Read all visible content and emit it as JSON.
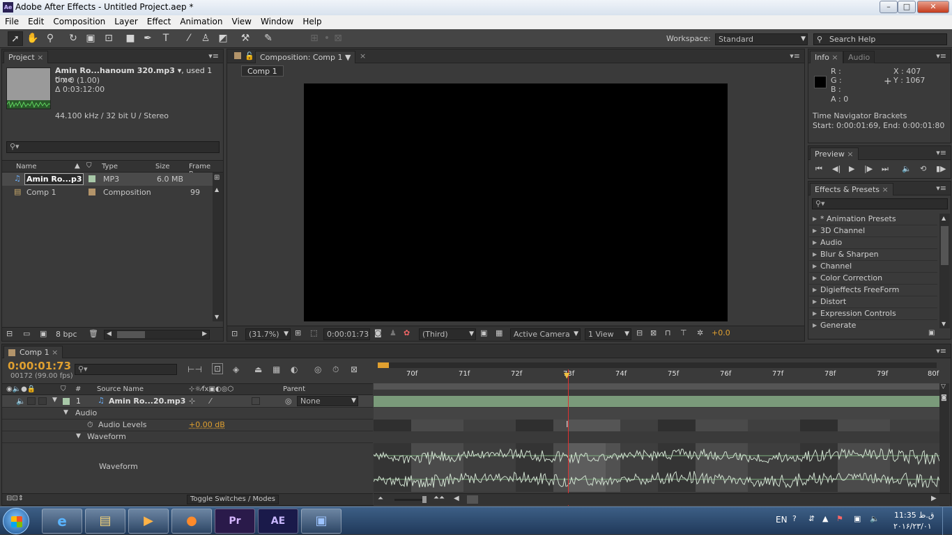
{
  "window": {
    "title": "Adobe After Effects - Untitled Project.aep *",
    "app_icon": "Ae",
    "min": "–",
    "max": "□",
    "close": "✕"
  },
  "menu": [
    "File",
    "Edit",
    "Composition",
    "Layer",
    "Effect",
    "Animation",
    "View",
    "Window",
    "Help"
  ],
  "toolbar": {
    "workspace_label": "Workspace:",
    "workspace_value": "Standard",
    "search_placeholder": "Search Help"
  },
  "project": {
    "tab": "Project",
    "item_title": "Amin Ro...hanoum 320.mp3",
    "item_used": ", used 1 time",
    "item_dims": "0 x 0 (1.00)",
    "item_duration": "Δ 0:03:12:00",
    "item_audio": "44.100 kHz / 32 bit U / Stereo",
    "columns": [
      "Name",
      "Type",
      "Size",
      "Frame R..."
    ],
    "rows": [
      {
        "name": "Amin Ro...p3",
        "type": "MP3",
        "size": "6.0 MB",
        "rate": "",
        "color": "#a8c8a8"
      },
      {
        "name": "Comp 1",
        "type": "Composition",
        "size": "",
        "rate": "99",
        "color": "#b3946a"
      }
    ],
    "bpc": "8 bpc"
  },
  "composition": {
    "tab": "Composition: Comp 1",
    "subtab": "Comp 1",
    "zoom": "(31.7%)",
    "timecode": "0:00:01:73",
    "resolution": "(Third)",
    "camera": "Active Camera",
    "view": "1 View",
    "exposure": "+0.0"
  },
  "info": {
    "tab_info": "Info",
    "tab_audio": "Audio",
    "r": "R :",
    "g": "G :",
    "b": "B :",
    "a": "A : 0",
    "x": "X : 407",
    "y": "Y : 1067",
    "line1": "Time Navigator Brackets",
    "line2": "Start: 0:00:01:69, End: 0:00:01:80"
  },
  "preview": {
    "tab": "Preview"
  },
  "effects": {
    "tab": "Effects & Presets",
    "items": [
      "* Animation Presets",
      "3D Channel",
      "Audio",
      "Blur & Sharpen",
      "Channel",
      "Color Correction",
      "Digieffects FreeForm",
      "Distort",
      "Expression Controls",
      "Generate"
    ]
  },
  "timeline": {
    "tab": "Comp 1",
    "timecode": "0:00:01:73",
    "frame_info": "00172 (99.00 fps)",
    "columns": {
      "num": "#",
      "source": "Source Name",
      "parent": "Parent"
    },
    "layer_num": "1",
    "layer_name": "Amin Ro...20.mp3",
    "parent_value": "None",
    "audio_label": "Audio",
    "levels_label": "Audio Levels",
    "levels_value": "+0.00 dB",
    "waveform_group": "Waveform",
    "waveform_label": "Waveform",
    "toggle": "Toggle Switches / Modes",
    "ruler": [
      "70f",
      "71f",
      "72f",
      "73f",
      "74f",
      "75f",
      "76f",
      "77f",
      "78f",
      "79f",
      "80f"
    ]
  },
  "taskbar": {
    "lang": "EN",
    "time": "11:35 ق.ظ",
    "date": "٢٠١۶/٢٣/٠١",
    "apps": [
      "ie-icon",
      "explorer-icon",
      "media-player-icon",
      "firefox-icon",
      "Pr",
      "AE",
      "document-icon"
    ]
  }
}
